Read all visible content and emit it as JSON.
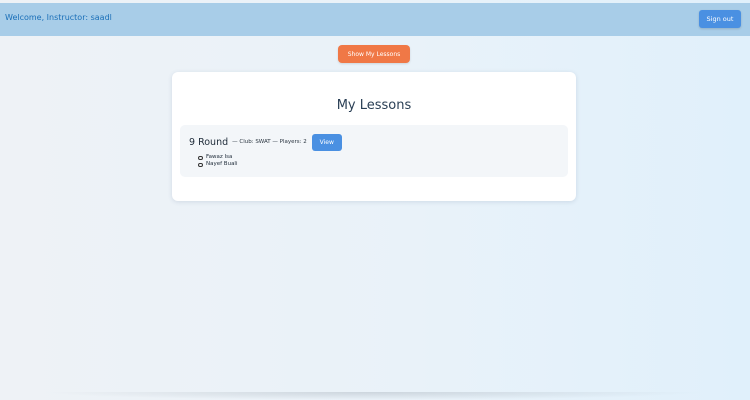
{
  "header": {
    "welcome_text": "Welcome, Instructor: saadl",
    "signout_label": "Sign out"
  },
  "toolbar": {
    "show_lessons_label": "Show My Lessons"
  },
  "lessons_card": {
    "title": "My Lessons",
    "lessons": [
      {
        "name": "9 Round",
        "meta": "— Club: SWAT — Players: 2",
        "view_label": "View",
        "players": [
          "Fawaz Isa",
          "Nayef Buali"
        ]
      }
    ]
  },
  "colors": {
    "header_bg": "#a8cde8",
    "primary_button": "#4a90e2",
    "accent_button": "#f07846",
    "welcome_text": "#1a6fb8"
  }
}
